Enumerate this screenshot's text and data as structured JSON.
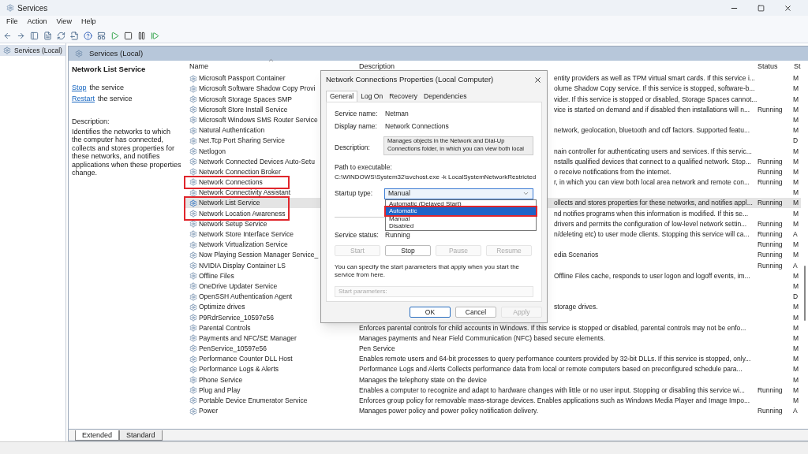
{
  "window": {
    "title": "Services"
  },
  "menu": [
    "File",
    "Action",
    "View",
    "Help"
  ],
  "tree": [
    {
      "label": "Services (Local)",
      "selected": true
    }
  ],
  "panel_title": "Services (Local)",
  "details": {
    "title": "Network List Service",
    "links": [
      {
        "link": "Stop",
        "rest": "the service"
      },
      {
        "link": "Restart",
        "rest": "the service"
      }
    ],
    "description_label": "Description:",
    "description": "Identifies the networks to which the computer has connected, collects and stores properties for these networks, and notifies applications when these properties change."
  },
  "columns": [
    {
      "label": "Name",
      "sorted": true
    },
    {
      "label": "Description"
    },
    {
      "label": "Status"
    },
    {
      "label": "St"
    }
  ],
  "rows": [
    {
      "name": "Microsoft Passport Container",
      "description": "entity providers as well as TPM virtual smart cards. If this service i...",
      "startup": "M",
      "under_dialog": true,
      "selected": false
    },
    {
      "name": "Microsoft Software Shadow Copy Provi",
      "description": "olume Shadow Copy service. If this service is stopped, software-b...",
      "startup": "M",
      "under_dialog": true,
      "selected": false
    },
    {
      "name": "Microsoft Storage Spaces SMP",
      "description": "vider. If this service is stopped or disabled, Storage Spaces cannot...",
      "startup": "M",
      "under_dialog": true,
      "selected": false
    },
    {
      "name": "Microsoft Store Install Service",
      "description": "vice is started on demand and if disabled then installations will n...",
      "status": "Running",
      "startup": "M",
      "under_dialog": true,
      "selected": false
    },
    {
      "name": "Microsoft Windows SMS Router Service",
      "startup": "M",
      "selected": false
    },
    {
      "name": "Natural Authentication",
      "description": "network, geolocation, bluetooth and cdf factors. Supported featu...",
      "startup": "M",
      "under_dialog": true,
      "selected": false
    },
    {
      "name": "Net.Tcp Port Sharing Service",
      "startup": "D",
      "selected": false
    },
    {
      "name": "Netlogon",
      "description": "nain controller for authenticating users and services. If this servic...",
      "startup": "M",
      "under_dialog": true,
      "selected": false
    },
    {
      "name": "Network Connected Devices Auto-Setu",
      "description": "nstalls qualified devices that connect to a qualified network. Stop...",
      "status": "Running",
      "startup": "M",
      "under_dialog": true,
      "selected": false
    },
    {
      "name": "Network Connection Broker",
      "description": "o receive notifications from the internet.",
      "status": "Running",
      "startup": "M",
      "under_dialog": true,
      "selected": false
    },
    {
      "name": "Network Connections",
      "description": "r, in which you can view both local area network and remote con...",
      "status": "Running",
      "startup": "M",
      "under_dialog": true,
      "selected": false,
      "annotated": true
    },
    {
      "name": "Network Connectivity Assistant",
      "startup": "M",
      "selected": false
    },
    {
      "name": "Network List Service",
      "description": "ollects and stores properties for these networks, and notifies appl...",
      "status": "Running",
      "startup": "M",
      "under_dialog": true,
      "selected": true,
      "annotated": true
    },
    {
      "name": "Network Location Awareness",
      "description": "nd notifies programs when this information is modified. If this se...",
      "startup": "M",
      "under_dialog": true,
      "selected": false,
      "annotated": true
    },
    {
      "name": "Network Setup Service",
      "description": "drivers and permits the configuration of low-level network settin...",
      "status": "Running",
      "startup": "M",
      "under_dialog": true,
      "selected": false
    },
    {
      "name": "Network Store Interface Service",
      "description": "n/deleting etc) to user mode clients. Stopping this service will ca...",
      "status": "Running",
      "startup": "A",
      "under_dialog": true,
      "selected": false
    },
    {
      "name": "Network Virtualization Service",
      "status": "Running",
      "startup": "M",
      "selected": false
    },
    {
      "name": "Now Playing Session Manager Service_",
      "description": "edia Scenarios",
      "status": "Running",
      "startup": "M",
      "under_dialog": true,
      "selected": false
    },
    {
      "name": "NVIDIA Display Container LS",
      "status": "Running",
      "startup": "A",
      "selected": false
    },
    {
      "name": "Offline Files",
      "description": "Offline Files cache, responds to user logon and logoff events, im...",
      "startup": "M",
      "under_dialog": true,
      "selected": false
    },
    {
      "name": "OneDrive Updater Service",
      "startup": "M",
      "selected": false
    },
    {
      "name": "OpenSSH Authentication Agent",
      "startup": "D",
      "selected": false
    },
    {
      "name": "Optimize drives",
      "description": "storage drives.",
      "startup": "M",
      "under_dialog": true,
      "selected": false
    },
    {
      "name": "P9RdrService_10597e56",
      "startup": "M",
      "selected": false
    },
    {
      "name": "Parental Controls",
      "description": "Enforces parental controls for child accounts in Windows. If this service is stopped or disabled, parental controls may not be enfo...",
      "startup": "M",
      "under_dialog": false,
      "selected": false
    },
    {
      "name": "Payments and NFC/SE Manager",
      "description": "Manages payments and Near Field Communication (NFC) based secure elements.",
      "startup": "M",
      "under_dialog": false,
      "selected": false
    },
    {
      "name": "PenService_10597e56",
      "description": "Pen Service",
      "startup": "M",
      "under_dialog": false,
      "selected": false
    },
    {
      "name": "Performance Counter DLL Host",
      "description": "Enables remote users and 64-bit processes to query performance counters provided by 32-bit DLLs. If this service is stopped, only...",
      "startup": "M",
      "under_dialog": false,
      "selected": false
    },
    {
      "name": "Performance Logs & Alerts",
      "description": "Performance Logs and Alerts Collects performance data from local or remote computers based on preconfigured schedule para...",
      "startup": "M",
      "under_dialog": false,
      "selected": false
    },
    {
      "name": "Phone Service",
      "description": "Manages the telephony state on the device",
      "startup": "M",
      "under_dialog": false,
      "selected": false
    },
    {
      "name": "Plug and Play",
      "description": "Enables a computer to recognize and adapt to hardware changes with little or no user input. Stopping or disabling this service wi...",
      "status": "Running",
      "startup": "M",
      "under_dialog": false,
      "selected": false
    },
    {
      "name": "Portable Device Enumerator Service",
      "description": "Enforces group policy for removable mass-storage devices. Enables applications such as Windows Media Player and Image Impo...",
      "startup": "M",
      "under_dialog": false,
      "selected": false
    },
    {
      "name": "Power",
      "description": "Manages power policy and power policy notification delivery.",
      "status": "Running",
      "startup": "A",
      "under_dialog": false,
      "selected": false
    }
  ],
  "view_tabs": [
    {
      "label": "Extended",
      "selected": true
    },
    {
      "label": "Standard",
      "selected": false
    }
  ],
  "dialog": {
    "title": "Network Connections Properties (Local Computer)",
    "tabs": [
      {
        "label": "General",
        "selected": true
      },
      {
        "label": "Log On",
        "selected": false
      },
      {
        "label": "Recovery",
        "selected": false
      },
      {
        "label": "Dependencies",
        "selected": false
      }
    ],
    "fields": [
      {
        "label": "Service name:",
        "value": "Netman"
      },
      {
        "label": "Display name:",
        "value": "Network Connections"
      }
    ],
    "description_label": "Description:",
    "description": "Manages objects in the Network and Dial-Up Connections folder, in which you can view both local",
    "path_label": "Path to executable:",
    "path": "C:\\WINDOWS\\System32\\svchost.exe -k LocalSystemNetworkRestricted",
    "startup_label": "Startup type:",
    "startup_value": "Manual",
    "dropdown_open": true,
    "options": [
      {
        "label": "Automatic (Delayed Start)",
        "selected": false,
        "annotated": false
      },
      {
        "label": "Automatic",
        "selected": true,
        "annotated": true
      },
      {
        "label": "Manual",
        "selected": false,
        "annotated": false
      },
      {
        "label": "Disabled",
        "selected": false,
        "annotated": false
      }
    ],
    "status_label": "Service status:",
    "status_value": "Running",
    "service_buttons": [
      {
        "label": "Start",
        "disabled": true
      },
      {
        "label": "Stop",
        "disabled": false
      },
      {
        "label": "Pause",
        "disabled": true
      },
      {
        "label": "Resume",
        "disabled": true
      }
    ],
    "hint": "You can specify the start parameters that apply when you start the service from here.",
    "params_label": "Start parameters:",
    "buttons": [
      {
        "label": "OK",
        "disabled": false,
        "default": true
      },
      {
        "label": "Cancel",
        "disabled": false,
        "default": false
      },
      {
        "label": "Apply",
        "disabled": true,
        "default": false
      }
    ]
  }
}
